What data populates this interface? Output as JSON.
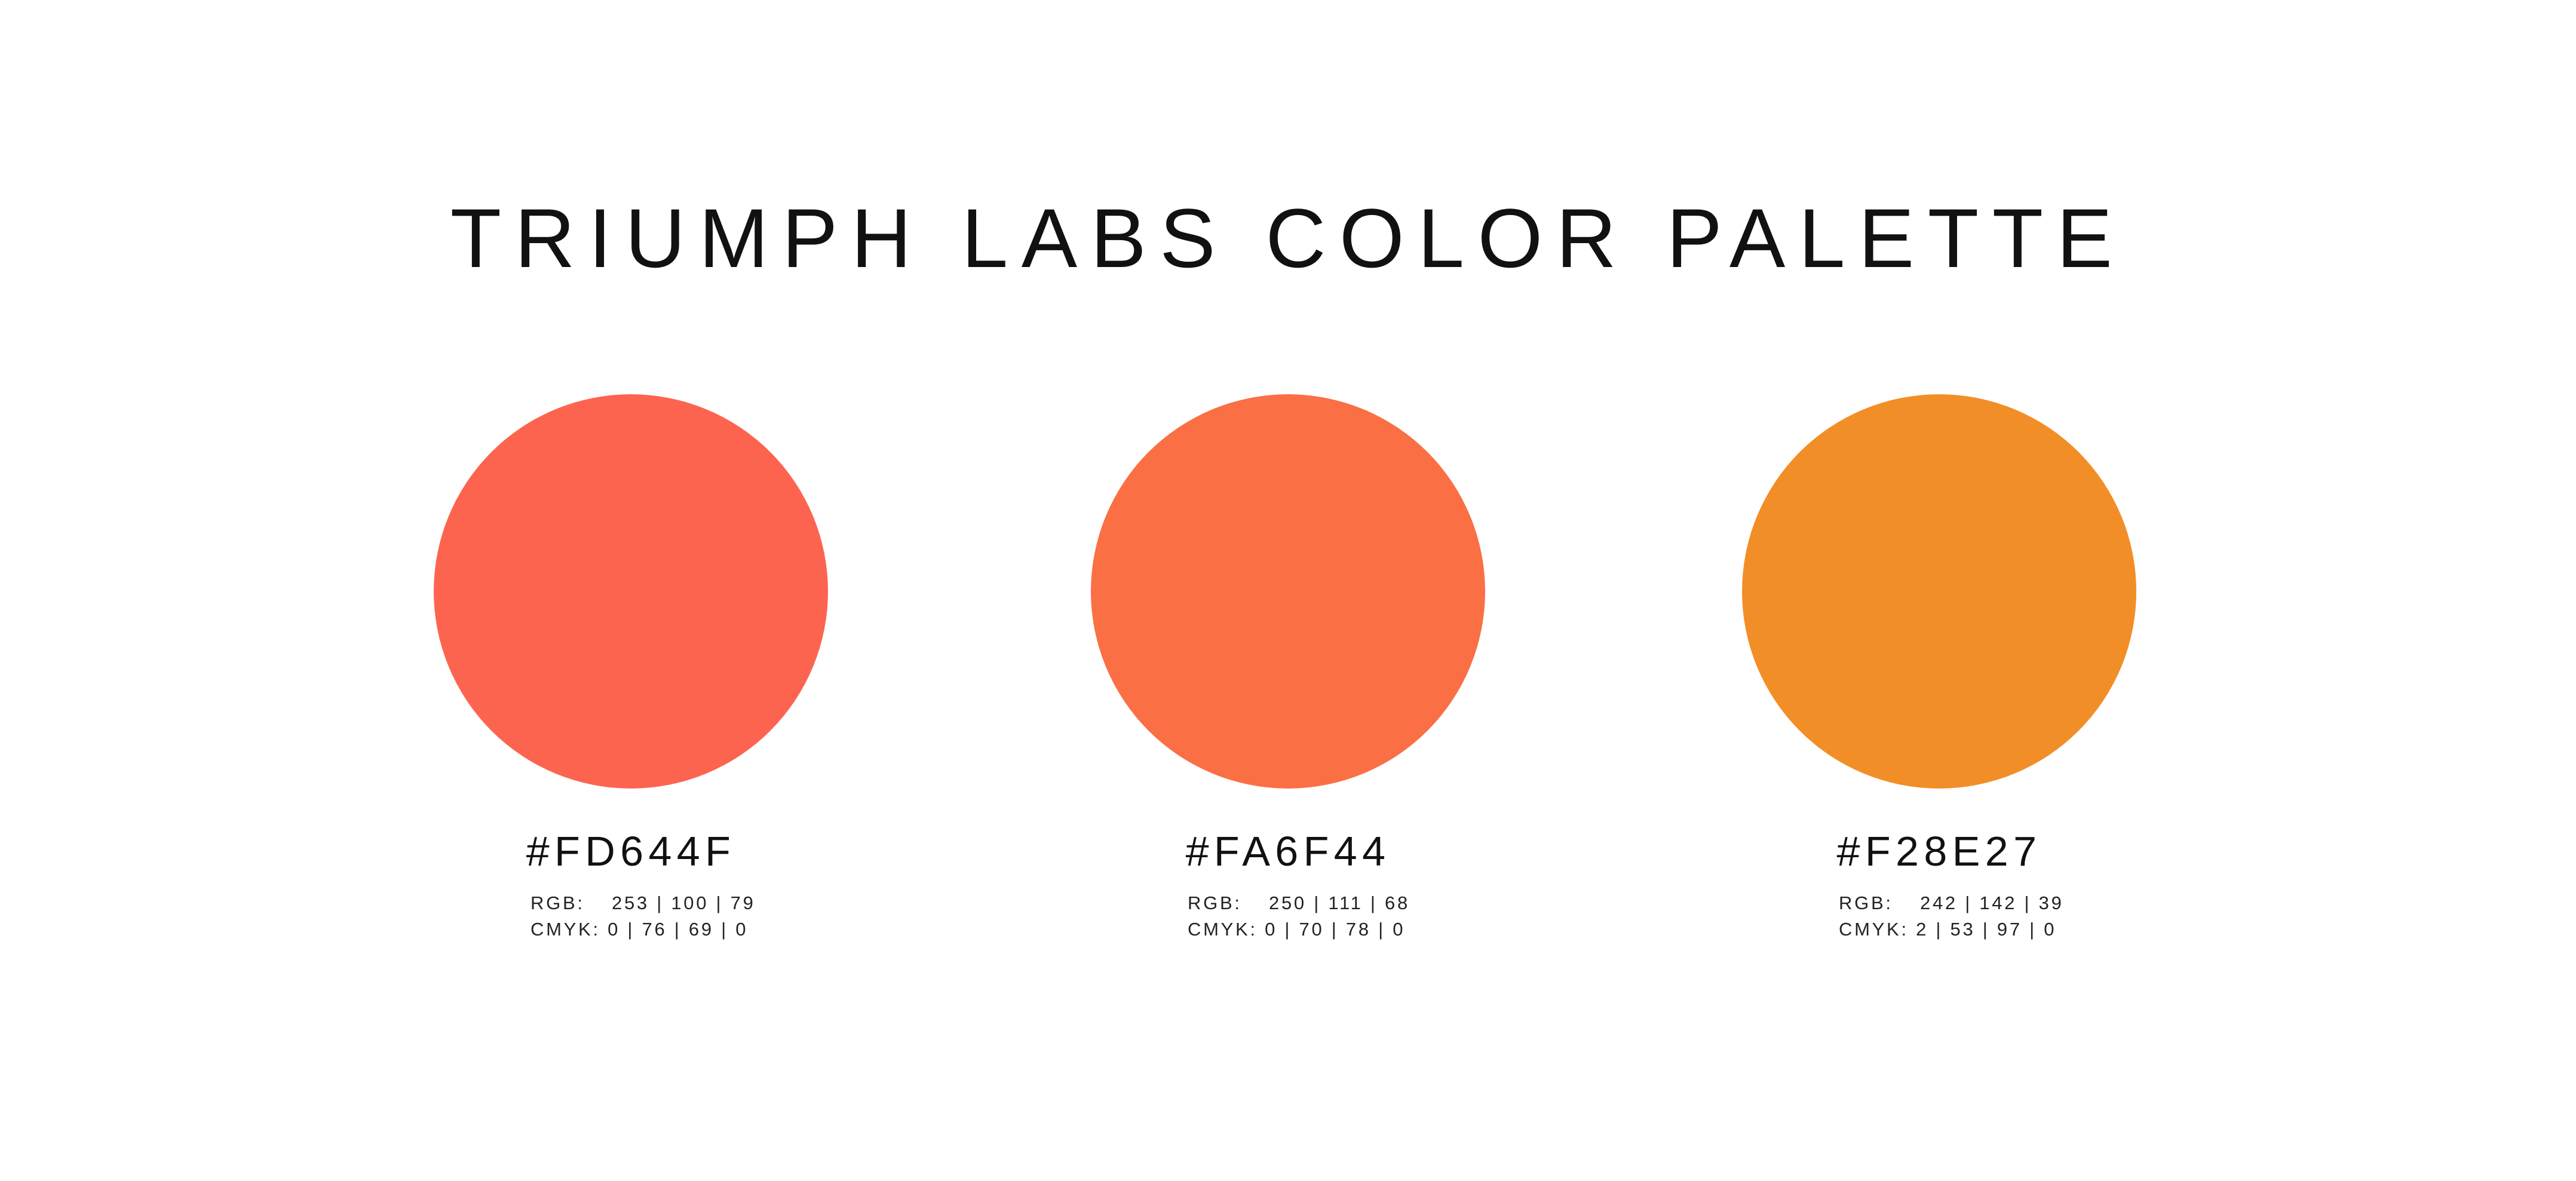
{
  "page": {
    "title": "TRIUMPH LABS COLOR PALETTE",
    "background_color": "#FFFFFF"
  },
  "swatches": [
    {
      "hex": "#FD644F",
      "color": "#FD644F",
      "rgb_label": "RGB:",
      "rgb_value": "253 | 100 | 79",
      "cmyk_label": "CMYK:",
      "cmyk_value": "0 | 76 | 69 | 0"
    },
    {
      "hex": "#FA6F44",
      "color": "#FA6F44",
      "rgb_label": "RGB:",
      "rgb_value": "250 | 111 | 68",
      "cmyk_label": "CMYK:",
      "cmyk_value": "0 | 70 | 78 | 0"
    },
    {
      "hex": "#F28E27",
      "color": "#F28E27",
      "rgb_label": "RGB:",
      "rgb_value": "242 | 142 | 39",
      "cmyk_label": "CMYK:",
      "cmyk_value": "2 | 53 | 97 | 0"
    }
  ]
}
